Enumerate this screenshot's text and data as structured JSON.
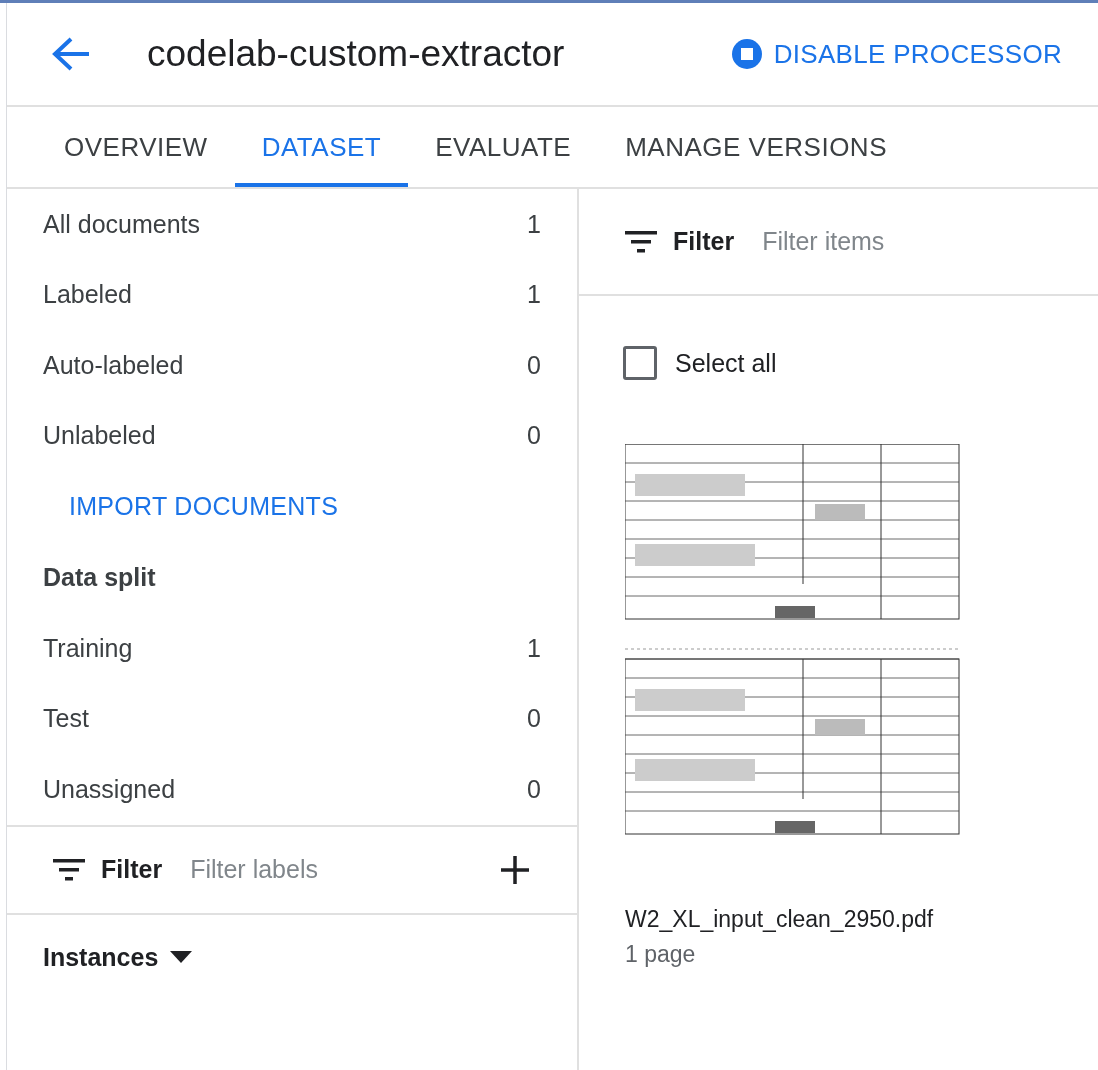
{
  "header": {
    "title": "codelab-custom-extractor",
    "action": "DISABLE PROCESSOR"
  },
  "tabs": [
    {
      "label": "OVERVIEW",
      "selected": false
    },
    {
      "label": "DATASET",
      "selected": true
    },
    {
      "label": "EVALUATE",
      "selected": false
    },
    {
      "label": "MANAGE VERSIONS",
      "selected": false
    }
  ],
  "documents": [
    {
      "label": "All documents",
      "count": "1"
    },
    {
      "label": "Labeled",
      "count": "1"
    },
    {
      "label": "Auto-labeled",
      "count": "0"
    },
    {
      "label": "Unlabeled",
      "count": "0"
    }
  ],
  "import_button": "IMPORT DOCUMENTS",
  "data_split": {
    "heading": "Data split",
    "items": [
      {
        "label": "Training",
        "count": "1"
      },
      {
        "label": "Test",
        "count": "0"
      },
      {
        "label": "Unassigned",
        "count": "0"
      }
    ]
  },
  "label_filter": {
    "label": "Filter",
    "placeholder": "Filter labels"
  },
  "instances": {
    "label": "Instances"
  },
  "item_filter": {
    "label": "Filter",
    "placeholder": "Filter items"
  },
  "select_all": {
    "label": "Select all",
    "checked": false
  },
  "files": [
    {
      "name": "W2_XL_input_clean_2950.pdf",
      "pages": "1 page"
    }
  ]
}
